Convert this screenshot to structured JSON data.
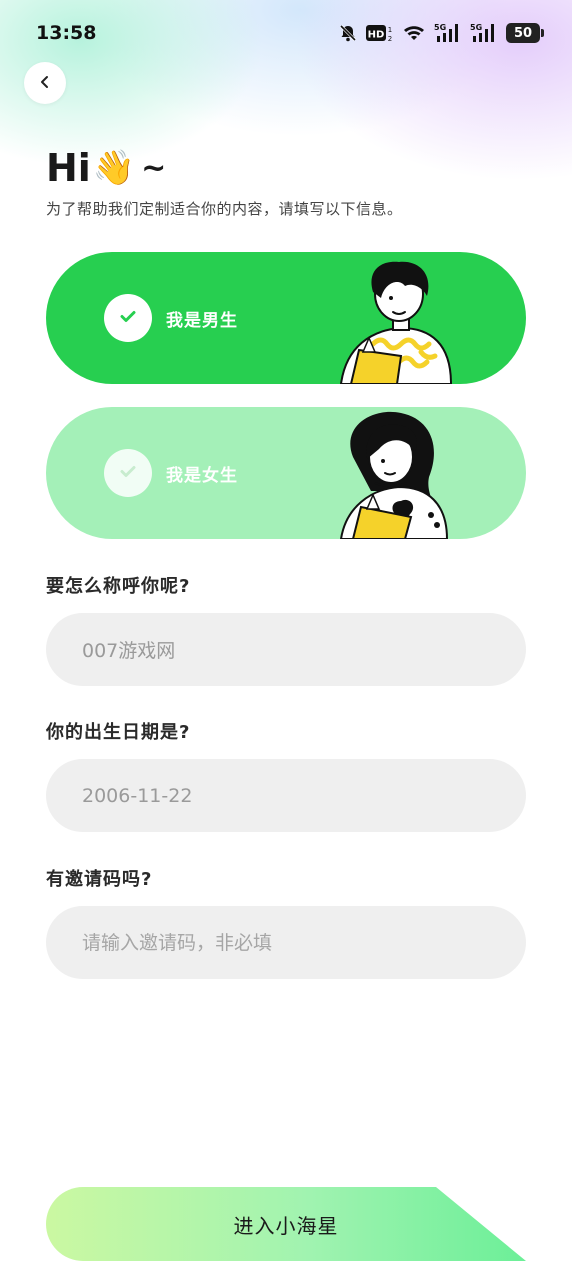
{
  "status_bar": {
    "time": "13:58",
    "battery": "50",
    "icons": [
      "bell-off-icon",
      "hd-icon",
      "wifi-icon",
      "signal-5g-icon",
      "signal-5g-icon",
      "battery-icon"
    ]
  },
  "header": {
    "back_icon": "chevron-left-icon",
    "greeting": "Hi",
    "greeting_emoji": "👋",
    "greeting_tilde": "~",
    "subtitle": "为了帮助我们定制适合你的内容，请填写以下信息。"
  },
  "gender": {
    "male_label": "我是男生",
    "female_label": "我是女生",
    "selected": "male",
    "colors": {
      "selected": "#27cf50",
      "unselected": "#a4f0b8"
    }
  },
  "form": {
    "nickname_label": "要怎么称呼你呢?",
    "nickname_value": "007游戏网",
    "birthday_label": "你的出生日期是?",
    "birthday_value": "2006-11-22",
    "invite_label": "有邀请码吗?",
    "invite_placeholder": "请输入邀请码，非必填"
  },
  "submit": {
    "label": "进入小海星"
  }
}
